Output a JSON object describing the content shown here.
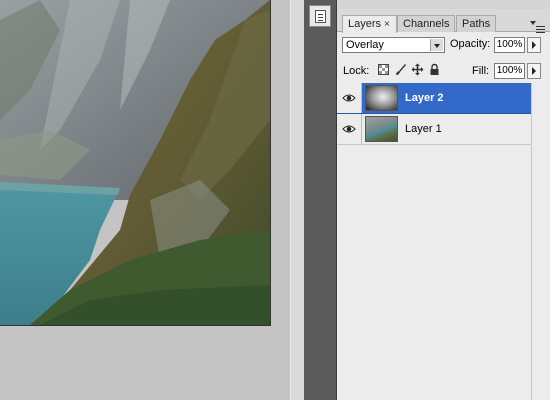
{
  "layers_panel": {
    "tabs": [
      {
        "label": "Layers",
        "close": "×"
      },
      {
        "label": "Channels"
      },
      {
        "label": "Paths"
      }
    ],
    "blend_mode": "Overlay",
    "opacity_label": "Opacity:",
    "opacity_value": "100%",
    "lock_label": "Lock:",
    "fill_label": "Fill:",
    "fill_value": "100%",
    "layers": [
      {
        "name": "Layer 2",
        "selected": true
      },
      {
        "name": "Layer 1",
        "selected": false
      }
    ]
  },
  "colors": {
    "selection": "#3369c9",
    "panel_bg": "#ececec",
    "dock_strip": "#5b5b5b",
    "workspace": "#c4c4c4"
  },
  "icons": [
    "panel-document-icon",
    "lock-transparent-icon",
    "lock-brush-icon",
    "lock-move-icon",
    "lock-all-icon",
    "eye-icon",
    "panel-menu-icon",
    "dropdown-arrow-icon",
    "slider-arrow-icon"
  ]
}
